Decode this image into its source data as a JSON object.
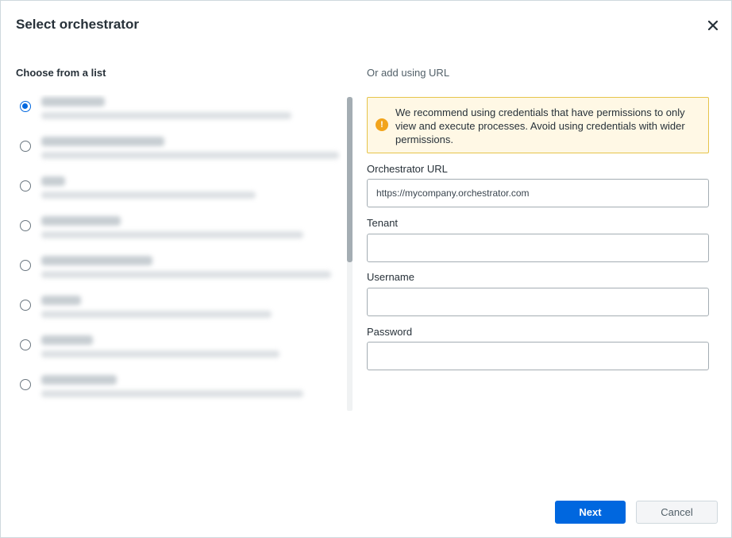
{
  "dialog": {
    "title": "Select orchestrator",
    "close_icon": "close-icon"
  },
  "left": {
    "label": "Choose from a list",
    "items": [
      {
        "selected": true
      },
      {
        "selected": false
      },
      {
        "selected": false
      },
      {
        "selected": false
      },
      {
        "selected": false
      },
      {
        "selected": false
      },
      {
        "selected": false
      },
      {
        "selected": false
      }
    ]
  },
  "right": {
    "label": "Or add using URL",
    "alert": {
      "icon": "warning-icon",
      "text": "We recommend using credentials that have permissions to only view and execute processes. Avoid using credentials with wider permissions."
    },
    "fields": {
      "url": {
        "label": "Orchestrator URL",
        "placeholder": "https://mycompany.orchestrator.com",
        "value": ""
      },
      "tenant": {
        "label": "Tenant",
        "value": ""
      },
      "username": {
        "label": "Username",
        "value": ""
      },
      "password": {
        "label": "Password",
        "value": ""
      }
    }
  },
  "footer": {
    "next_label": "Next",
    "cancel_label": "Cancel"
  },
  "colors": {
    "primary": "#0067df",
    "warning": "#f2a41b",
    "alert_bg": "#fff8e5"
  }
}
